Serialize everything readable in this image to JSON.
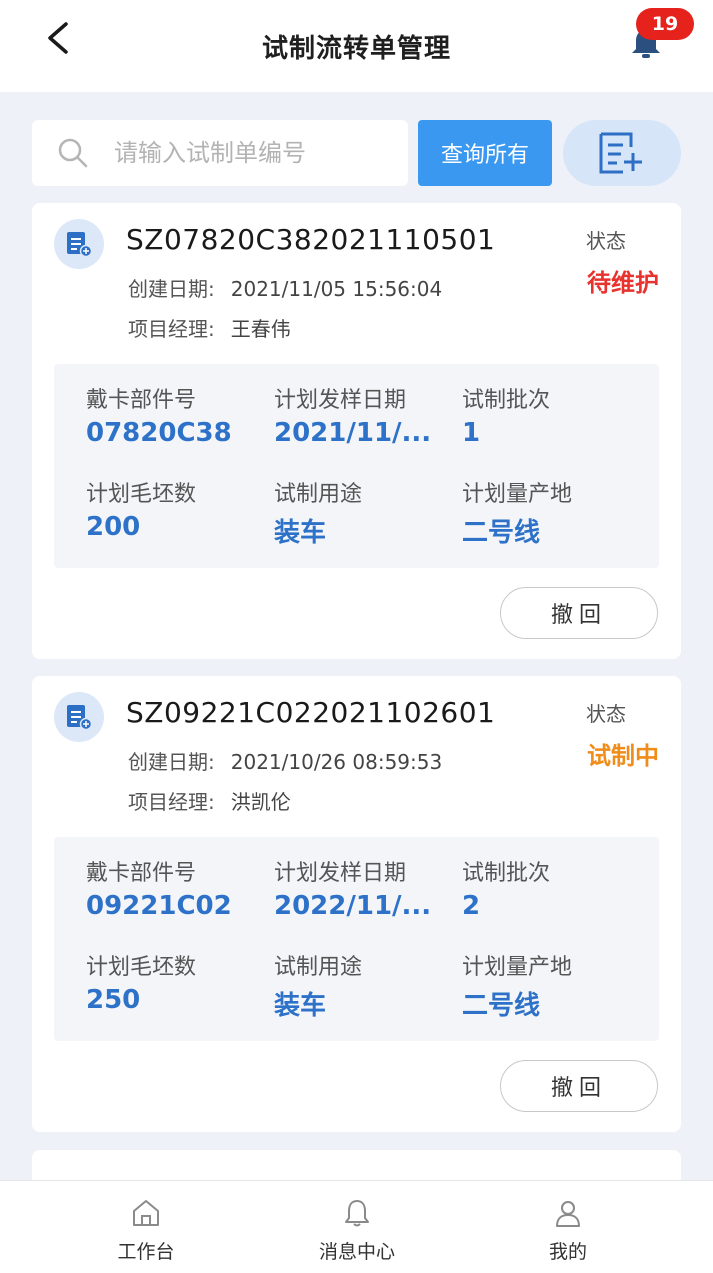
{
  "header": {
    "title": "试制流转单管理",
    "notification_count": "19"
  },
  "search": {
    "placeholder": "请输入试制单编号",
    "query_all_label": "查询所有"
  },
  "labels": {
    "created_date": "创建日期:",
    "project_manager": "项目经理:",
    "status": "状态",
    "part_no": "戴卡部件号",
    "plan_sample_date": "计划发样日期",
    "batch": "试制批次",
    "blank_count": "计划毛坯数",
    "purpose": "试制用途",
    "production_site": "计划量产地",
    "revoke": "撤回"
  },
  "orders": [
    {
      "order_no": "SZ07820C382021110501",
      "created_date": "2021/11/05 15:56:04",
      "project_manager": "王春伟",
      "status": "待维护",
      "status_color": "#e8322e",
      "part_no": "07820C38",
      "plan_sample_date": "2021/11/...",
      "batch": "1",
      "blank_count": "200",
      "purpose": "装车",
      "production_site": "二号线"
    },
    {
      "order_no": "SZ09221C022021102601",
      "created_date": "2021/10/26 08:59:53",
      "project_manager": "洪凯伦",
      "status": "试制中",
      "status_color": "#f08c1a",
      "part_no": "09221C02",
      "plan_sample_date": "2022/11/...",
      "batch": "2",
      "blank_count": "250",
      "purpose": "装车",
      "production_site": "二号线"
    }
  ],
  "bottom_nav": [
    {
      "label": "工作台",
      "icon": "home-icon"
    },
    {
      "label": "消息中心",
      "icon": "bell-icon"
    },
    {
      "label": "我的",
      "icon": "user-icon"
    }
  ],
  "colors": {
    "accent": "#3a98f0",
    "value_blue": "#2d72c8",
    "background": "#eef2f8"
  }
}
